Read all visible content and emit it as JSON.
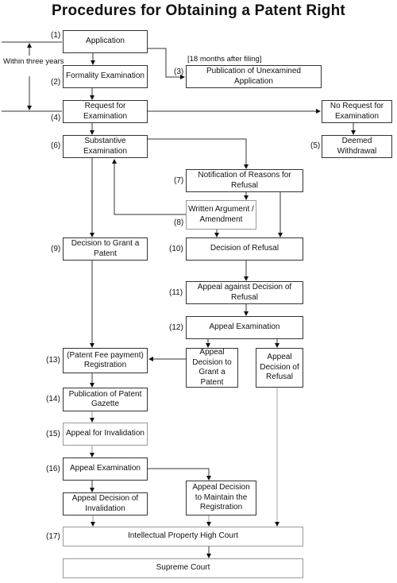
{
  "title": "Procedures for Obtaining a Patent Right",
  "side_note": "Within three years",
  "bracket_note": "[18 months after filing]",
  "nodes": {
    "application": {
      "num": "(1)",
      "label": "Application"
    },
    "formality": {
      "num": "(2)",
      "label": "Formality Examination"
    },
    "publication_unexamined": {
      "num": "(3)",
      "label": "Publication of Unexamined Application"
    },
    "request_exam": {
      "num": "(4)",
      "label": "Request for Examination"
    },
    "no_request": {
      "label": "No Request for Examination"
    },
    "deemed_withdrawal": {
      "num": "(5)",
      "label": "Deemed Withdrawal"
    },
    "substantive": {
      "num": "(6)",
      "label": "Substantive Examination"
    },
    "notification": {
      "num": "(7)",
      "label": "Notification of Reasons for Refusal"
    },
    "written_argument": {
      "num": "(8)",
      "label": "Written Argument / Amendment"
    },
    "decision_grant": {
      "num": "(9)",
      "label": "Decision to Grant a Patent"
    },
    "decision_refusal": {
      "num": "(10)",
      "label": "Decision of Refusal"
    },
    "appeal_against": {
      "num": "(11)",
      "label": "Appeal against Decision of Refusal"
    },
    "appeal_exam_12": {
      "num": "(12)",
      "label": "Appeal Examination"
    },
    "registration": {
      "num": "(13)",
      "label": "(Patent Fee payment) Registration"
    },
    "appeal_decision_grant": {
      "label": "Appeal Decision to Grant a Patent"
    },
    "appeal_decision_refusal": {
      "label": "Appeal Decision of Refusal"
    },
    "gazette": {
      "num": "(14)",
      "label": "Publication of Patent Gazette"
    },
    "appeal_invalidation": {
      "num": "(15)",
      "label": "Appeal for Invalidation"
    },
    "appeal_exam_16": {
      "num": "(16)",
      "label": "Appeal Examination"
    },
    "decision_invalidation": {
      "label": "Appeal Decision of Invalidation"
    },
    "maintain_registration": {
      "label": "Appeal Decision to Maintain the Registration"
    },
    "ip_high_court": {
      "num": "(17)",
      "label": "Intellectual Property High Court"
    },
    "supreme_court": {
      "label": "Supreme Court"
    }
  }
}
